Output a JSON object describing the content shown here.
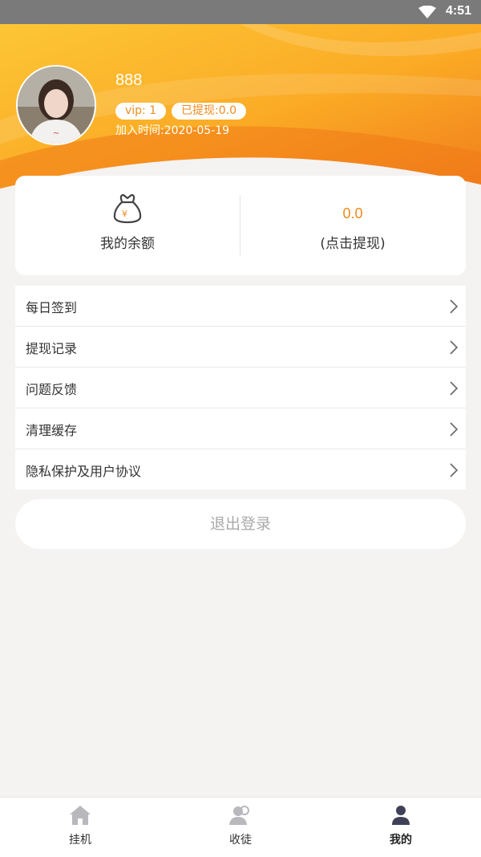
{
  "status_bar": {
    "time": "4:51"
  },
  "profile": {
    "username": "888",
    "vip_badge": "vip: 1",
    "withdrawn_badge": "已提现:0.0",
    "join_date": "加入时间:2020-05-19"
  },
  "balance": {
    "label": "我的余额",
    "amount": "0.0",
    "action": "(点击提现)"
  },
  "menu": {
    "items": [
      {
        "label": "每日签到"
      },
      {
        "label": "提现记录"
      },
      {
        "label": "问题反馈"
      },
      {
        "label": "清理缓存"
      },
      {
        "label": "隐私保护及用户协议"
      }
    ]
  },
  "logout_label": "退出登录",
  "tabs": [
    {
      "label": "挂机",
      "icon": "home-icon"
    },
    {
      "label": "收徒",
      "icon": "apprentice-icon"
    },
    {
      "label": "我的",
      "icon": "profile-icon"
    }
  ],
  "colors": {
    "accent": "#f08a1c",
    "header_gradient_start": "#fbbf2f",
    "header_gradient_end": "#f07d1c"
  }
}
